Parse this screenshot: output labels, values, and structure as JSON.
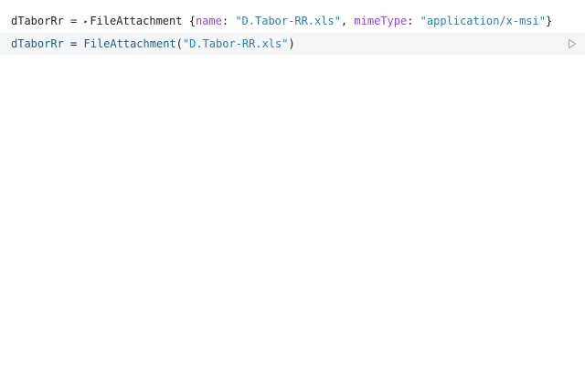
{
  "output": {
    "var_name": "dTaborRr",
    "equals": "=",
    "disclosure_glyph": "▸",
    "class_name": "FileAttachment",
    "open_brace": "{",
    "key_name": "name",
    "colon1": ":",
    "val_name": "\"D.Tabor-RR.xls\"",
    "comma": ",",
    "key_mime": "mimeType",
    "colon2": ":",
    "val_mime": "\"application/x-msi\"",
    "close_brace": "}"
  },
  "cell": {
    "var_name": "dTaborRr",
    "equals": "=",
    "func": "FileAttachment",
    "open_paren": "(",
    "arg": "\"D.Tabor-RR.xls\"",
    "close_paren": ")",
    "run_icon": "play-outline-icon"
  },
  "colors": {
    "key": "#8f49c9",
    "string": "#2f7ea6",
    "code": "#1b5b96",
    "cell_bg": "#f5f6f7"
  }
}
